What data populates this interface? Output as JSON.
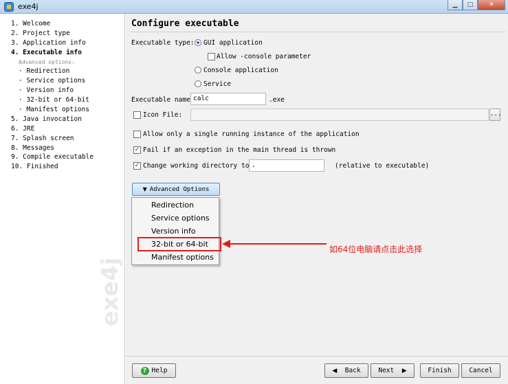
{
  "window": {
    "title": "exe4j",
    "minimize": "▁",
    "maximize": "□",
    "close": "✕"
  },
  "sidebar": {
    "items": [
      "1. Welcome",
      "2. Project type",
      "3. Application info",
      "4. Executable info",
      "Advanced options:",
      "Redirection",
      "Service options",
      "Version info",
      "32-bit or 64-bit",
      "Manifest options",
      "5. Java invocation",
      "6. JRE",
      "7. Splash screen",
      "8. Messages",
      "9. Compile executable",
      "10. Finished"
    ],
    "watermark": "exe4j"
  },
  "page": {
    "title": "Configure executable",
    "executable_type_label": "Executable type:",
    "gui_label": "GUI application",
    "allow_console_label": "Allow -console parameter",
    "console_label": "Console application",
    "service_label": "Service",
    "executable_name_label": "Executable name:",
    "executable_name_value": "calc",
    "exe_suffix": ".exe",
    "icon_file_label": "Icon File:",
    "icon_file_value": "",
    "browse_label": "...",
    "single_instance_label": "Allow only a single running instance of the application",
    "fail_exception_label": "Fail if an exception in the main thread is thrown",
    "change_dir_label": "Change working directory to:",
    "change_dir_value": ".",
    "relative_label": "(relative to executable)",
    "advanced_button_label": "Advanced Options",
    "check_mark": "✓"
  },
  "popup_menu": {
    "items": [
      "Redirection",
      "Service options",
      "Version info",
      "32-bit or 64-bit",
      "Manifest options"
    ]
  },
  "annotation": {
    "text": "如64位电脑请点击此选择",
    "color": "#e41b1b"
  },
  "footer": {
    "help": "Help",
    "back": "Back",
    "next": "Next",
    "finish": "Finish",
    "cancel": "Cancel"
  }
}
